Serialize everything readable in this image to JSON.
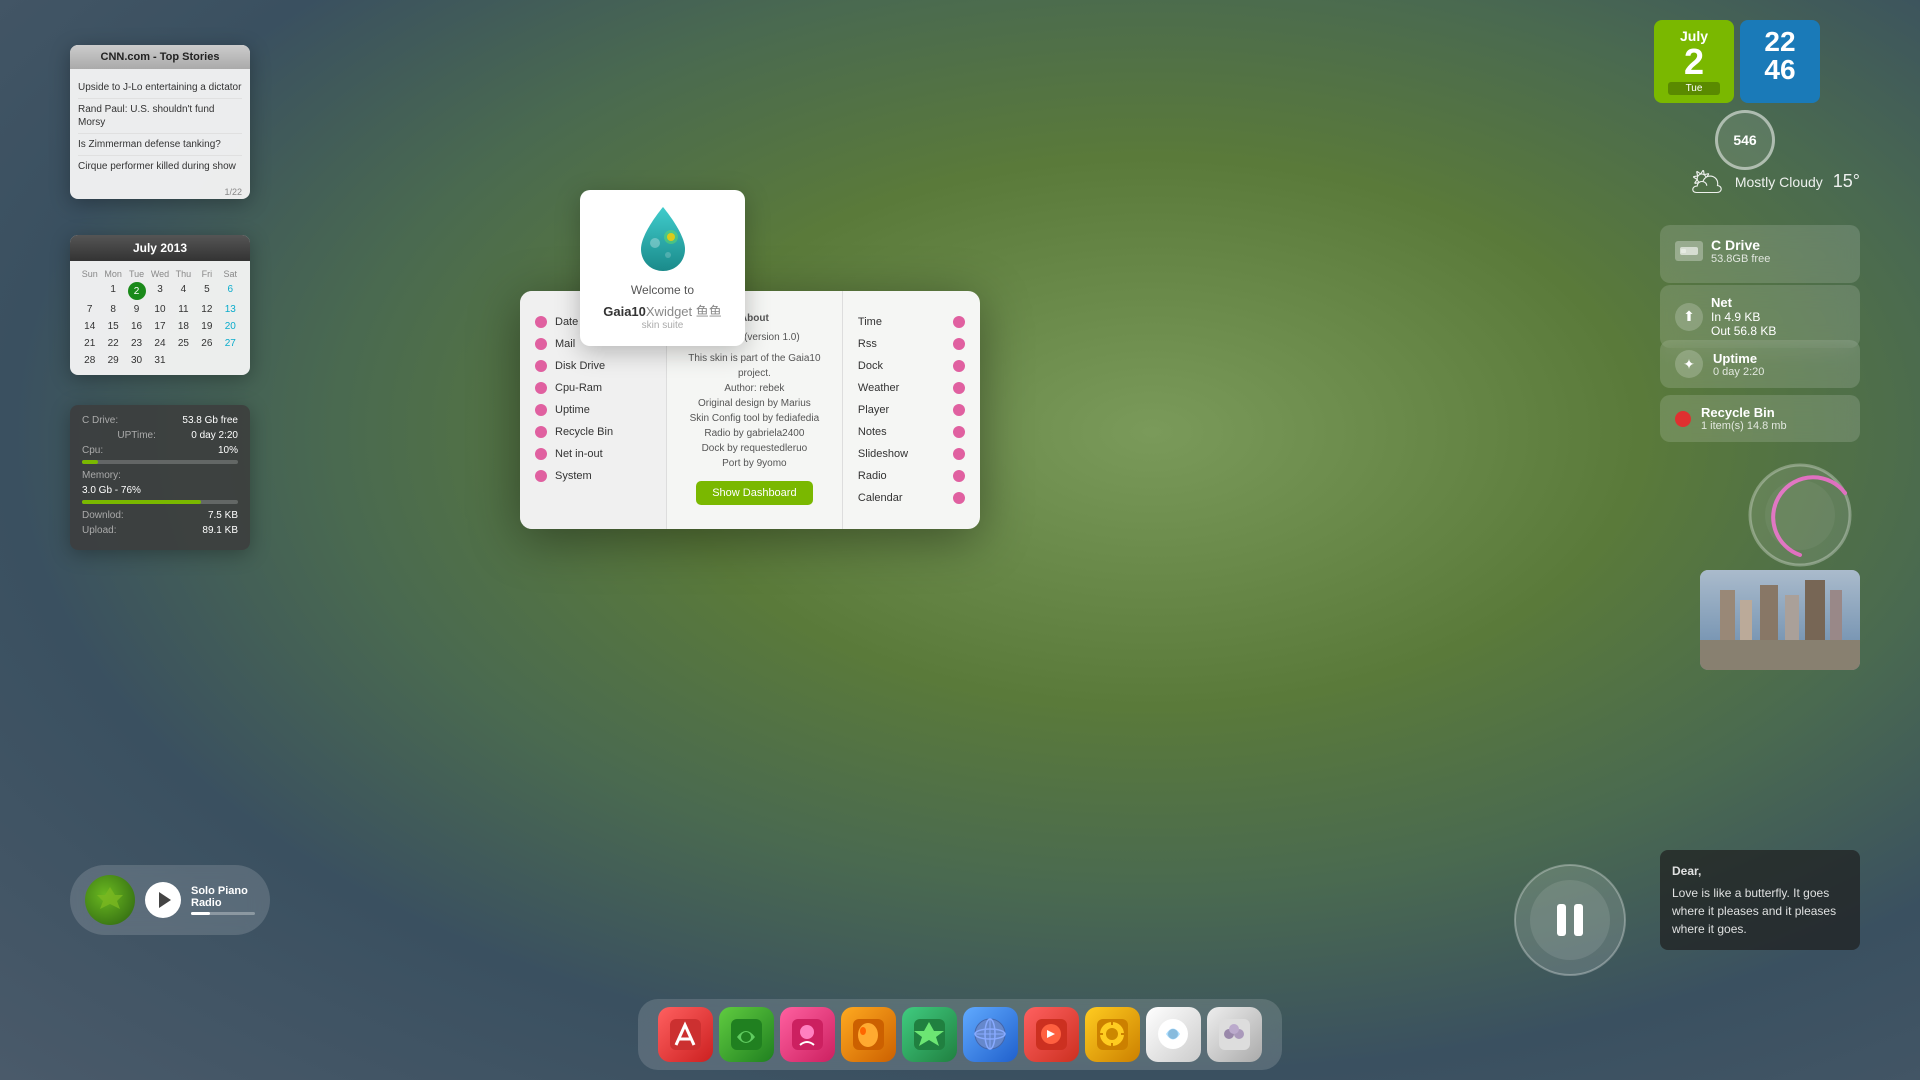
{
  "datetime": {
    "month": "July",
    "day": "2",
    "weekday": "Tue",
    "hours": "22",
    "minutes": "46"
  },
  "humidity": {
    "value": "546"
  },
  "weather": {
    "condition": "Mostly Cloudy",
    "temperature": "15°"
  },
  "cdrive": {
    "title": "C Drive",
    "free": "53.8GB free"
  },
  "net": {
    "title": "Net",
    "in_label": "In",
    "out_label": "Out",
    "in_value": "4.9 KB",
    "out_value": "56.8 KB"
  },
  "uptime": {
    "title": "Uptime",
    "value": "0 day 2:20"
  },
  "recycle": {
    "title": "Recycle Bin",
    "value": "1 item(s)   14.8 mb"
  },
  "cnn": {
    "title": "CNN.com - Top Stories",
    "items": [
      "Upside to J-Lo entertaining a dictator",
      "Rand Paul: U.S. shouldn't fund Morsy",
      "Is Zimmerman defense tanking?",
      "Cirque performer killed during show"
    ],
    "page": "1/22"
  },
  "calendar": {
    "title": "July 2013",
    "day_names": [
      "Sun",
      "Mon",
      "Tue",
      "Wed",
      "Thu",
      "Fri",
      "Sat"
    ],
    "days": [
      {
        "label": "",
        "empty": true
      },
      {
        "label": "1"
      },
      {
        "label": "2",
        "today": true
      },
      {
        "label": "3"
      },
      {
        "label": "4"
      },
      {
        "label": "5"
      },
      {
        "label": "6",
        "cyan": true
      },
      {
        "label": "7"
      },
      {
        "label": "8"
      },
      {
        "label": "9"
      },
      {
        "label": "10"
      },
      {
        "label": "11"
      },
      {
        "label": "12"
      },
      {
        "label": "13",
        "cyan": true
      },
      {
        "label": "14"
      },
      {
        "label": "15"
      },
      {
        "label": "16"
      },
      {
        "label": "17"
      },
      {
        "label": "18"
      },
      {
        "label": "19"
      },
      {
        "label": "20",
        "cyan": true
      },
      {
        "label": "21"
      },
      {
        "label": "22"
      },
      {
        "label": "23"
      },
      {
        "label": "24"
      },
      {
        "label": "25"
      },
      {
        "label": "26"
      },
      {
        "label": "27",
        "cyan": true
      },
      {
        "label": "28"
      },
      {
        "label": "29"
      },
      {
        "label": "30"
      },
      {
        "label": "31"
      }
    ]
  },
  "stats": {
    "cdrive_label": "C Drive:",
    "cdrive_free": "53.8 Gb free",
    "uptime_label": "UPTime:",
    "uptime_value": "0 day 2:20",
    "cpu_label": "Cpu:",
    "cpu_value": "10%",
    "memory_label": "Memory:",
    "memory_value": "3.0 Gb   -   76%",
    "download_label": "Downlod:",
    "download_value": "7.5 KB",
    "upload_label": "Upload:",
    "upload_value": "89.1 KB"
  },
  "media": {
    "title": "Solo Piano Radio",
    "artist": "♫"
  },
  "notes": {
    "salutation": "Dear,",
    "text": "Love is like a butterfly. It goes where it pleases and it pleases where it goes."
  },
  "dashboard": {
    "welcome": "Welcome to",
    "title": "Gaia10",
    "subtitle": "Xwidget 鱼鱼",
    "skin_suite": "skin suite",
    "about_title": "About",
    "version": "Gaia10 (version 1.0)",
    "about_text": "This skin is part of the Gaia10 project.\nAuthor: rebek\nOriginal design by Marius\nSkin Config tool by fediafedia\nRadio by gabriela2400\nDock by requestedleruo\nPort by 9yomo",
    "show_button": "Show Dashboard",
    "left_items": [
      "Date",
      "Mail",
      "Disk Drive",
      "Cpu-Ram",
      "Uptime",
      "Recycle Bin",
      "Net in-out",
      "System"
    ],
    "right_items": [
      "Time",
      "Rss",
      "Dock",
      "Weather",
      "Player",
      "Notes",
      "Slideshow",
      "Radio",
      "Calendar"
    ]
  },
  "dock": {
    "icons": [
      "🎨",
      "🌿",
      "🎀",
      "🐱",
      "🌱",
      "🌐",
      "🦊",
      "🎵",
      "🦄",
      "🌸"
    ]
  }
}
